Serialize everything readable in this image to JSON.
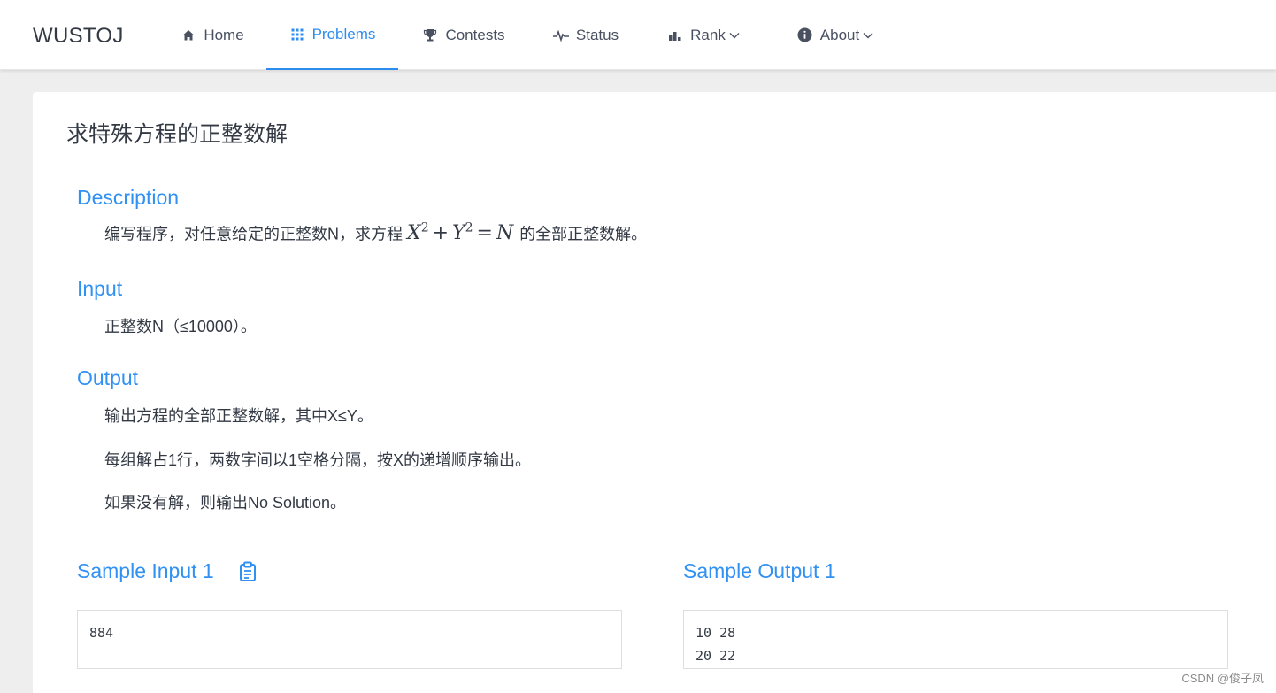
{
  "header": {
    "logo": "WUSTOJ",
    "nav": [
      {
        "label": "Home",
        "icon": "home-icon"
      },
      {
        "label": "Problems",
        "icon": "grid-icon",
        "active": true
      },
      {
        "label": "Contests",
        "icon": "trophy-icon"
      },
      {
        "label": "Status",
        "icon": "pulse-icon"
      },
      {
        "label": "Rank",
        "icon": "bar-chart-icon",
        "dropdown": true
      },
      {
        "label": "About",
        "icon": "info-icon",
        "dropdown": true
      }
    ],
    "accent_color": "#2d8cf0"
  },
  "problem": {
    "title": "求特殊方程的正整数解",
    "description": {
      "heading": "Description",
      "text_before": "编写程序，对任意给定的正整数N，求方程",
      "formula": {
        "x": "X",
        "y": "Y",
        "exp": "2",
        "plus": "+",
        "eq": "=",
        "n": "N"
      },
      "text_after": "的全部正整数解。"
    },
    "input": {
      "heading": "Input",
      "text": "正整数N（≤10000）。"
    },
    "output": {
      "heading": "Output",
      "lines": [
        "输出方程的全部正整数解，其中X≤Y。",
        "每组解占1行，两数字间以1空格分隔，按X的递增顺序输出。",
        "如果没有解，则输出No Solution。"
      ]
    },
    "sample_input": {
      "heading": "Sample Input 1",
      "lines": [
        "884"
      ]
    },
    "sample_output": {
      "heading": "Sample Output 1",
      "lines": [
        "10 28",
        "20 22"
      ]
    }
  },
  "watermark": "CSDN @俊子凤"
}
